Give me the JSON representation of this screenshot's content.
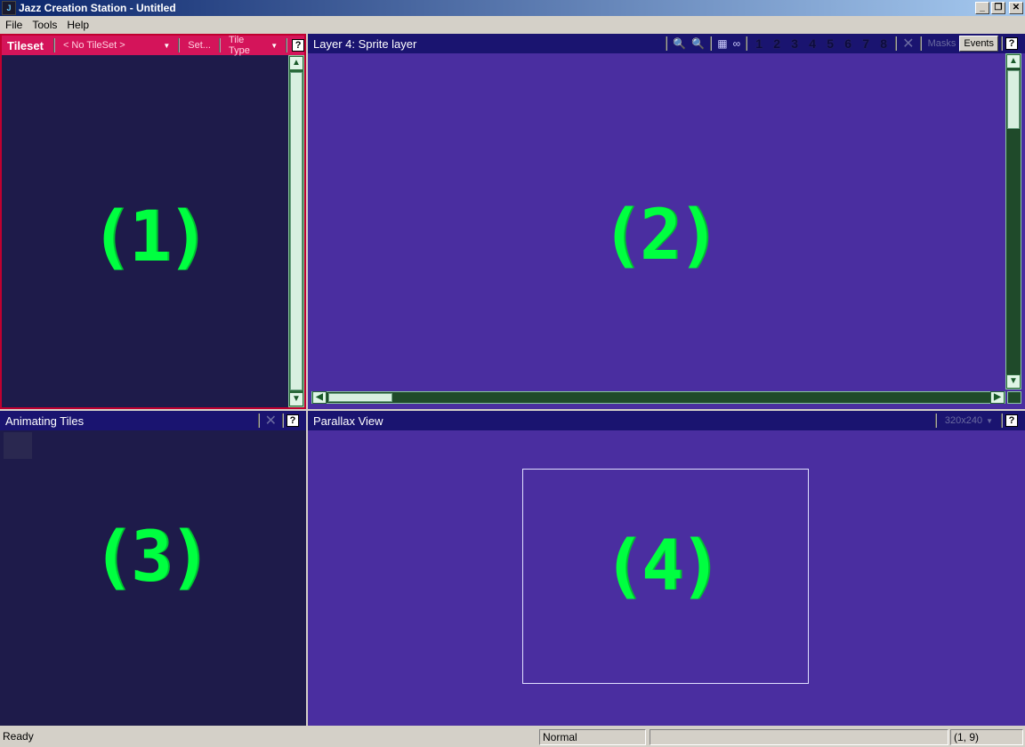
{
  "window": {
    "title": "Jazz Creation Station - Untitled",
    "controls": {
      "minimize": "_",
      "restore": "❐",
      "close": "✕"
    }
  },
  "menu": {
    "items": [
      {
        "label": "File"
      },
      {
        "label": "Tools"
      },
      {
        "label": "Help"
      }
    ]
  },
  "tileset_panel": {
    "title": "Tileset",
    "tileset_dropdown": "< No TileSet >",
    "set_button": "Set...",
    "tile_type_dropdown": "Tile Type",
    "help": "?",
    "placeholder_label": "(1)"
  },
  "layer_panel": {
    "title": "Layer 4: Sprite layer",
    "layer_buttons": [
      "1",
      "2",
      "3",
      "4",
      "5",
      "6",
      "7",
      "8"
    ],
    "masks_label": "Masks",
    "events_label": "Events",
    "help": "?",
    "placeholder_label": "(2)"
  },
  "anim_panel": {
    "title": "Animating Tiles",
    "help": "?",
    "placeholder_label": "(3)"
  },
  "parallax_panel": {
    "title": "Parallax View",
    "resolution_dropdown": "320x240",
    "help": "?",
    "placeholder_label": "(4)"
  },
  "status": {
    "message": "Ready",
    "mode": "Normal",
    "coords": "(1, 9)"
  },
  "colors": {
    "accent_tileset": "#d4145a",
    "panel_header": "#1a1470",
    "panel_bg": "#4a2ea0",
    "placeholder_green": "#00ff40"
  }
}
